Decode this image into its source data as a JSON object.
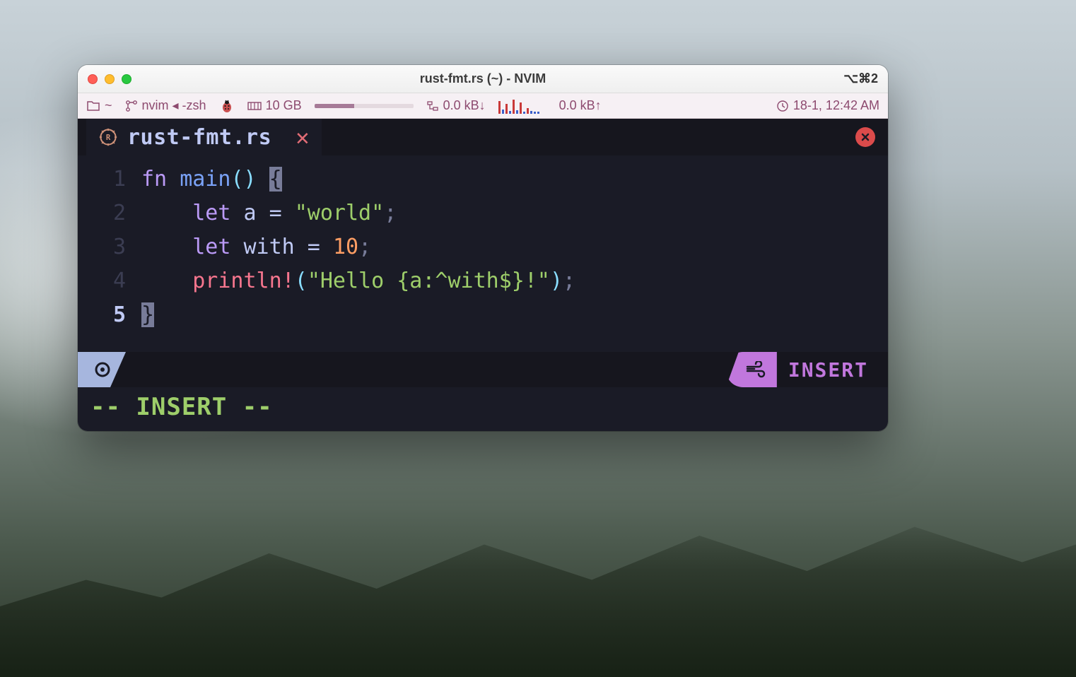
{
  "window": {
    "title": "rust-fmt.rs (~) - NVIM",
    "right_shortcut": "⌥⌘2"
  },
  "statusbar": {
    "cwd": "~",
    "process": "nvim ◂ -zsh",
    "memory": "10 GB",
    "net_down": "0.0 kB↓",
    "net_up": "0.0 kB↑",
    "datetime": "18-1, 12:42 AM"
  },
  "tab": {
    "filename": "rust-fmt.rs"
  },
  "code": {
    "lines": [
      {
        "n": "1",
        "tokens": [
          [
            "kw",
            "fn "
          ],
          [
            "fn",
            "main"
          ],
          [
            "punct",
            "() "
          ],
          [
            "cursor-block",
            "{"
          ]
        ]
      },
      {
        "n": "2",
        "tokens": [
          [
            "",
            "    "
          ],
          [
            "kw",
            "let "
          ],
          [
            "ident",
            "a"
          ],
          [
            "ident",
            " = "
          ],
          [
            "str",
            "\"world\""
          ],
          [
            "punct-muted",
            ";"
          ]
        ]
      },
      {
        "n": "3",
        "tokens": [
          [
            "",
            "    "
          ],
          [
            "kw",
            "let "
          ],
          [
            "ident",
            "with"
          ],
          [
            "ident",
            " = "
          ],
          [
            "num",
            "10"
          ],
          [
            "punct-muted",
            ";"
          ]
        ]
      },
      {
        "n": "4",
        "tokens": [
          [
            "",
            "    "
          ],
          [
            "macro",
            "println!"
          ],
          [
            "punct",
            "("
          ],
          [
            "str",
            "\"Hello {a:^with$}!\""
          ],
          [
            "punct",
            ")"
          ],
          [
            "punct-muted",
            ";"
          ]
        ]
      },
      {
        "n": "5",
        "active": true,
        "tokens": [
          [
            "cursor-block",
            "}"
          ]
        ]
      }
    ]
  },
  "statusline": {
    "mode_right": "INSERT"
  },
  "cmdline": "-- INSERT --"
}
